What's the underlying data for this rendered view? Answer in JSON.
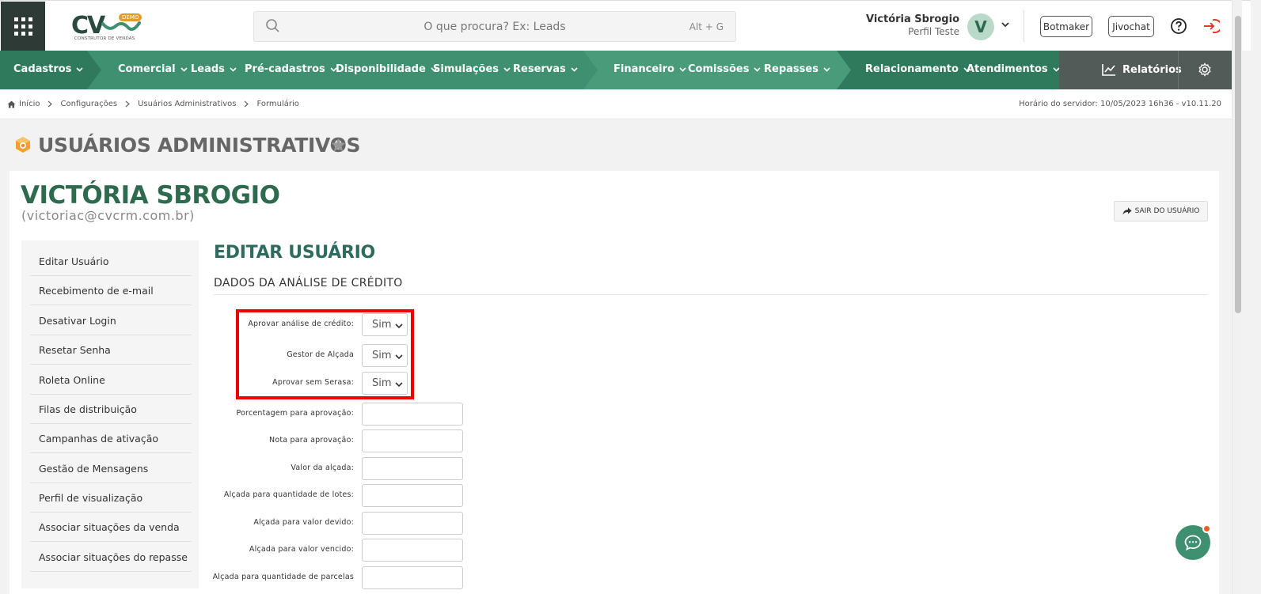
{
  "header": {
    "logo_text": "CV",
    "logo_badge": "DEMO",
    "logo_sub": "CONSTRUTOR DE VENDAS",
    "search_placeholder": "O que procura? Ex: Leads",
    "search_shortcut": "Alt + G",
    "user_name": "Victória Sbrogio",
    "user_profile": "Perfil Teste",
    "avatar_letter": "V",
    "botmaker_label": "Botmaker",
    "jivochat_label": "Jivochat"
  },
  "nav": {
    "items": [
      "Cadastros",
      "Comercial",
      "Leads",
      "Pré-cadastros",
      "Disponibilidade",
      "Simulações",
      "Reservas",
      "Financeiro",
      "Comissões",
      "Repasses",
      "Relacionamento",
      "Atendimentos"
    ],
    "reports_label": "Relatórios",
    "colors": {
      "dark": "#2f7a5c",
      "mid": "#3f9070",
      "light": "#4a9b7a",
      "report": "#535b58"
    }
  },
  "breadcrumb": {
    "items": [
      "Início",
      "Configurações",
      "Usuários Administrativos",
      "Formulário"
    ],
    "server_time": "Horário do servidor: 10/05/2023 16h36 - v10.11.20"
  },
  "page": {
    "title": "USUÁRIOS ADMINISTRATIVOS",
    "user_heading": "VICTÓRIA SBROGIO",
    "user_email": "(victoriac@cvcrm.com.br)",
    "exit_user_label": "SAIR DO USUÁRIO"
  },
  "sidebar": {
    "items": [
      "Editar Usuário",
      "Recebimento de e-mail",
      "Desativar Login",
      "Resetar Senha",
      "Roleta Online",
      "Filas de distribuição",
      "Campanhas de ativação",
      "Gestão de Mensagens",
      "Perfil de visualização",
      "Associar situações da venda",
      "Associar situações do repasse"
    ]
  },
  "form": {
    "title": "EDITAR USUÁRIO",
    "section": "DADOS DA ANÁLISE DE CRÉDITO",
    "selects": [
      {
        "label": "Aprovar análise de crédito:",
        "value": "Sim"
      },
      {
        "label": "Gestor de Alçada",
        "value": "Sim"
      },
      {
        "label": "Aprovar sem Serasa:",
        "value": "Sim"
      }
    ],
    "inputs": [
      {
        "label": "Porcentagem para aprovação:",
        "value": ""
      },
      {
        "label": "Nota para aprovação:",
        "value": ""
      },
      {
        "label": "Valor da alçada:",
        "value": ""
      },
      {
        "label": "Alçada para quantidade de lotes:",
        "value": ""
      },
      {
        "label": "Alçada para valor devido:",
        "value": ""
      },
      {
        "label": "Alçada para valor vencido:",
        "value": ""
      },
      {
        "label": "Alçada para quantidade de parcelas",
        "value": ""
      }
    ]
  },
  "icons": [
    "apps-grid-icon",
    "search-icon",
    "chevron-down-icon",
    "help-icon",
    "logout-icon",
    "chart-icon",
    "gear-icon",
    "home-icon",
    "chevron-right-icon",
    "box-icon",
    "star-icon",
    "share-icon",
    "chat-icon"
  ],
  "accent_color": "#3f9070",
  "highlight_color": "#e00000"
}
